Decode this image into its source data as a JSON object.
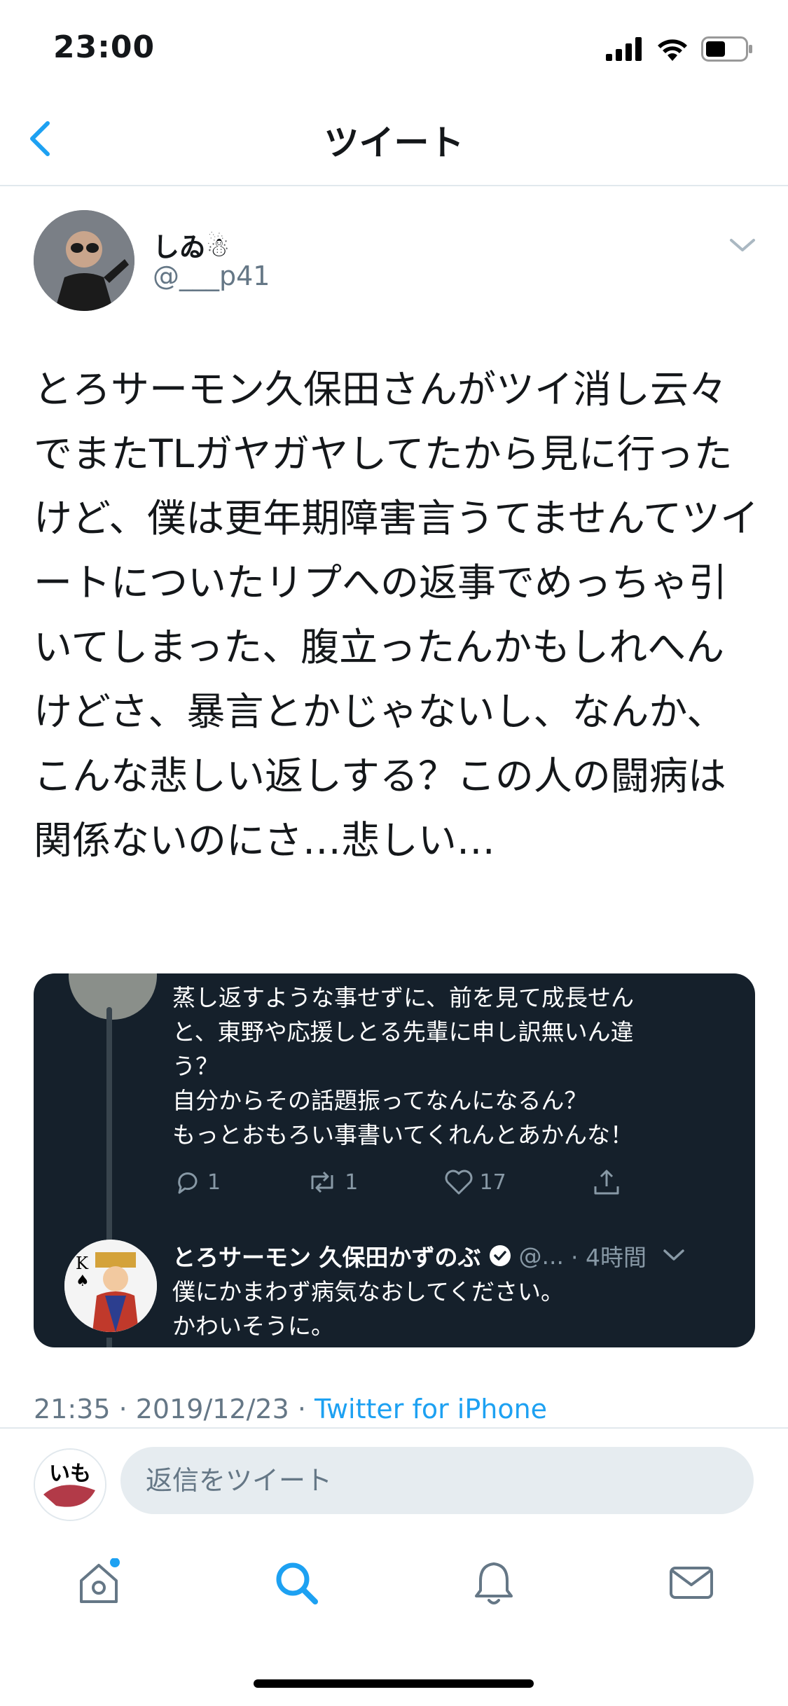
{
  "status": {
    "time": "23:00"
  },
  "nav": {
    "title": "ツイート"
  },
  "tweet": {
    "author_name": "しゐ☃",
    "author_handle": "@___p41",
    "text": "とろサーモン久保田さんがツイ消し云々でまたTLガヤガヤしてたから見に行ったけど、僕は更年期障害言うてませんてツイートについたリプへの返事でめっちゃ引いてしまった、腹立ったんかもしれへんけどさ、暴言とかじゃないし、なんか、こんな悲しい返しする？この人の闘病は関係ないのにさ…悲しい…",
    "timestamp": "21:35 · 2019/12/23 · ",
    "source": "Twitter for iPhone"
  },
  "embedded": {
    "reply_lines": [
      "蒸し返すような事せずに、前を見て成長せん",
      "と、東野や応援しとる先輩に申し訳無いん違",
      "う？",
      "自分からその話題振ってなんになるん？",
      "もっとおもろい事書いてくれんとあかんな！"
    ],
    "actions": {
      "reply_count": "1",
      "retweet_count": "1",
      "like_count": "17"
    },
    "name": "とろサーモン 久保田かずのぶ",
    "handle": "@...",
    "time": "· 4時間",
    "reply_text_lines": [
      "僕にかまわず病気なおしてください。",
      "かわいそうに。"
    ]
  },
  "reply_bar": {
    "placeholder": "返信をツイート"
  },
  "colors": {
    "accent": "#1da1f2",
    "dark_bg": "#15202b",
    "muted": "#657786"
  }
}
